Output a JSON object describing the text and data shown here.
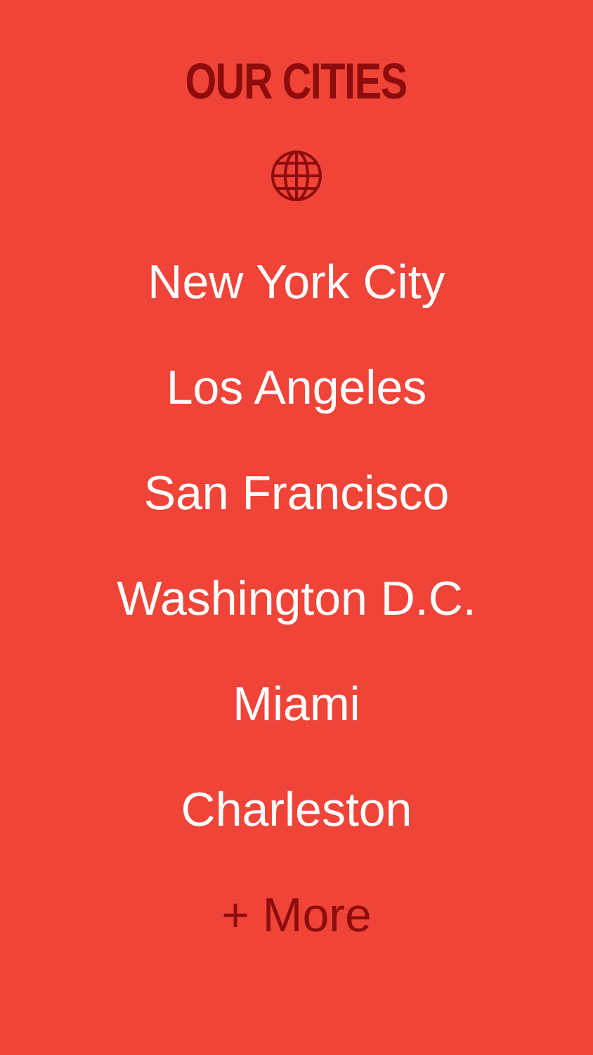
{
  "title": "OUR CITIES",
  "cities": [
    "New York City",
    "Los Angeles",
    "San Francisco",
    "Washington D.C.",
    "Miami",
    "Charleston"
  ],
  "more": "+ More"
}
